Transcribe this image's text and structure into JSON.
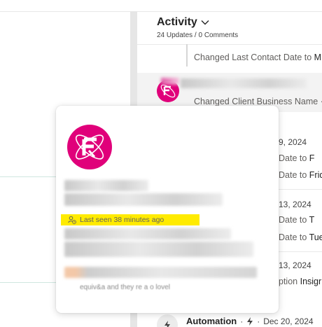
{
  "activity": {
    "title": "Activity",
    "chevron": "⌄",
    "subtitle": "24 Updates / 0 Comments"
  },
  "entries": [
    {
      "text_prefix": "Changed Last Contact Date to ",
      "text_value": "M"
    },
    {
      "text_prefix": "Changed Client Business Name ·",
      "text_value": ""
    }
  ],
  "partial": {
    "date1": "9, 2024",
    "line1a_prefix": "Date to ",
    "line1a_value": "F",
    "line1b_prefix": "Date to ",
    "line1b_value": "Frid",
    "date2": "13, 2024",
    "line2a_prefix": "Date to ",
    "line2a_value": "T",
    "line2b_prefix": "Date to ",
    "line2b_value": "Tue",
    "date3": "13, 2024",
    "line3_prefix": "ption ",
    "line3_value": "Insigr"
  },
  "automation": {
    "label": "Automation",
    "separator": "·",
    "bolt": "ϟ",
    "date": "Dec 20, 2024"
  },
  "card": {
    "last_seen": "Last seen 38 minutes ago",
    "faint_line": "equiv&a and they re a o lovel"
  },
  "icons": {
    "chevron": "chevron-down-icon",
    "user_clock": "user-clock-icon",
    "bolt": "bolt-icon",
    "automation": "automation-icon"
  },
  "colors": {
    "brand": "#e0007a",
    "highlight": "#ffeb00"
  }
}
